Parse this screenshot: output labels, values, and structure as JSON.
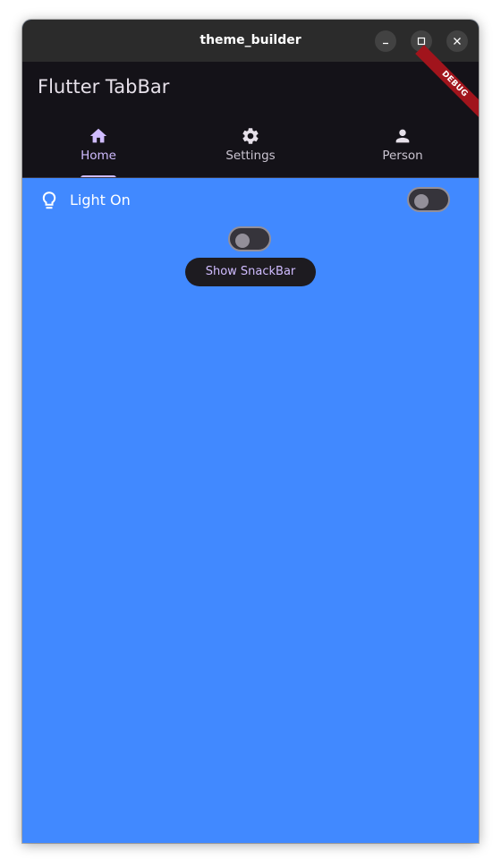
{
  "window": {
    "title": "theme_builder"
  },
  "appbar": {
    "title": "Flutter TabBar",
    "debug_banner": "DEBUG"
  },
  "tabs": [
    {
      "label": "Home",
      "icon": "home-icon",
      "active": true
    },
    {
      "label": "Settings",
      "icon": "gear-icon",
      "active": false
    },
    {
      "label": "Person",
      "icon": "person-icon",
      "active": false
    }
  ],
  "body": {
    "light_tile": {
      "label": "Light On",
      "icon": "lightbulb-icon",
      "switch_on": false
    },
    "center_switch_on": false,
    "snackbar_button": "Show SnackBar"
  },
  "colors": {
    "background": "#4189ff",
    "appbar": "#141218",
    "accent": "#d0bcff",
    "titlebar": "#2b2b2b",
    "debug": "#a1141c"
  }
}
